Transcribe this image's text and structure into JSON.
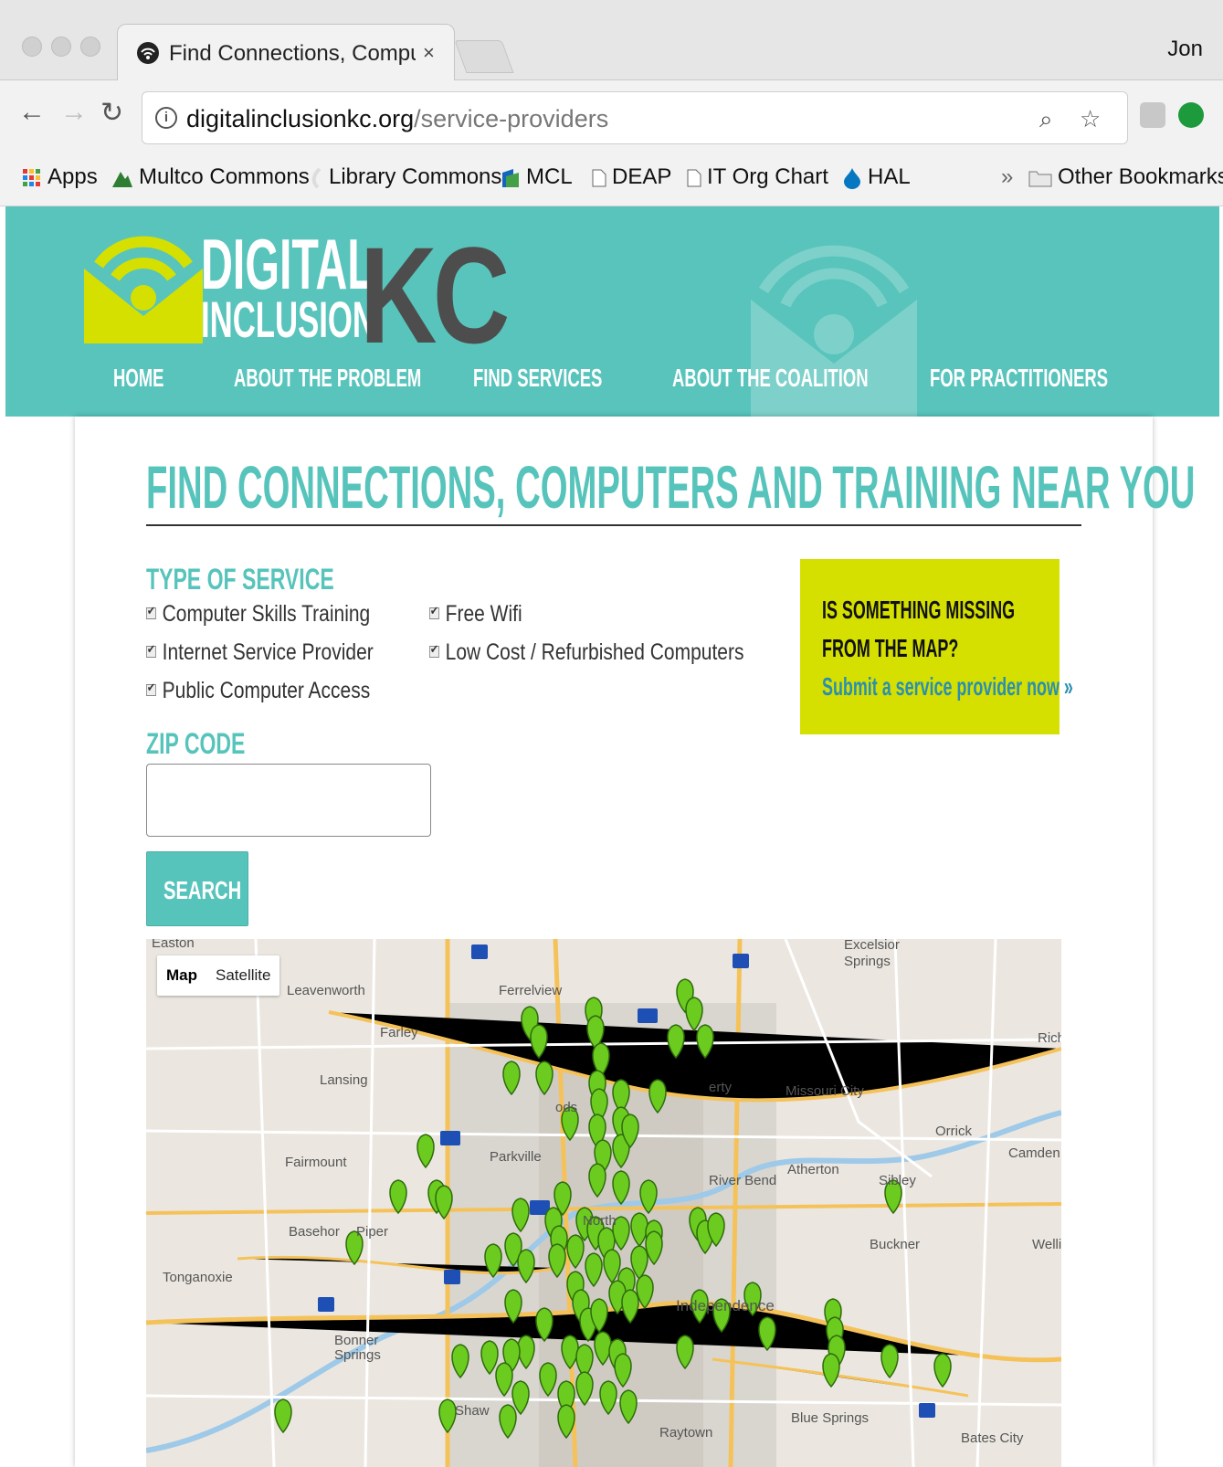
{
  "browser": {
    "tab_title": "Find Connections, Computers a",
    "tab_close": "×",
    "profile_name": "Jon",
    "url_domain": "digitalinclusionkc.org",
    "url_path": "/service-providers",
    "bookmarks": [
      "Apps",
      "Multco Commons",
      "Library Commons",
      "MCL",
      "DEAP",
      "IT Org Chart",
      "HAL"
    ],
    "bookmarks_overflow": "»",
    "other_bookmarks": "Other Bookmarks"
  },
  "site": {
    "logo_line1": "DIGITAL",
    "logo_line2": "INCLUSION",
    "logo_kc": "KC",
    "nav": [
      "HOME",
      "ABOUT THE PROBLEM",
      "FIND SERVICES",
      "ABOUT THE COALITION",
      "FOR PRACTITIONERS"
    ],
    "colors": {
      "teal": "#58c4bc",
      "lime": "#d5e000",
      "dark": "#4d4d4d",
      "pin_green": "#6ccb1f"
    }
  },
  "main": {
    "title": "FIND CONNECTIONS, COMPUTERS AND TRAINING NEAR YOU",
    "type_label": "TYPE OF SERVICE",
    "services": [
      {
        "label": "Computer Skills Training",
        "checked": true
      },
      {
        "label": "Internet Service Provider",
        "checked": true
      },
      {
        "label": "Public Computer Access",
        "checked": true
      },
      {
        "label": "Free Wifi",
        "checked": true
      },
      {
        "label": "Low Cost / Refurbished Computers",
        "checked": true
      }
    ],
    "zip_label": "ZIP CODE",
    "zip_value": "",
    "search_label": "SEARCH",
    "missing_line1": "IS SOMETHING MISSING",
    "missing_line2": "FROM THE MAP?",
    "missing_link": "Submit a service provider now »"
  },
  "map": {
    "toggle": [
      "Map",
      "Satellite"
    ],
    "active": "Map",
    "places": [
      "Easton",
      "Leavenworth",
      "Ferrelview",
      "Excelsior Springs",
      "Farley",
      "Lansing",
      "Missouri City",
      "Orrick",
      "Camden",
      "Parkville",
      "Fairmount",
      "River Bend",
      "Atherton",
      "Sibley",
      "Basehor",
      "Piper",
      "Buckner",
      "Tonganoxie",
      "Independence",
      "Bonner Springs",
      "Raytown",
      "Blue Springs",
      "Bates City",
      "Rich",
      "Welli",
      "North",
      "Shaw",
      "ods",
      "erty"
    ]
  }
}
